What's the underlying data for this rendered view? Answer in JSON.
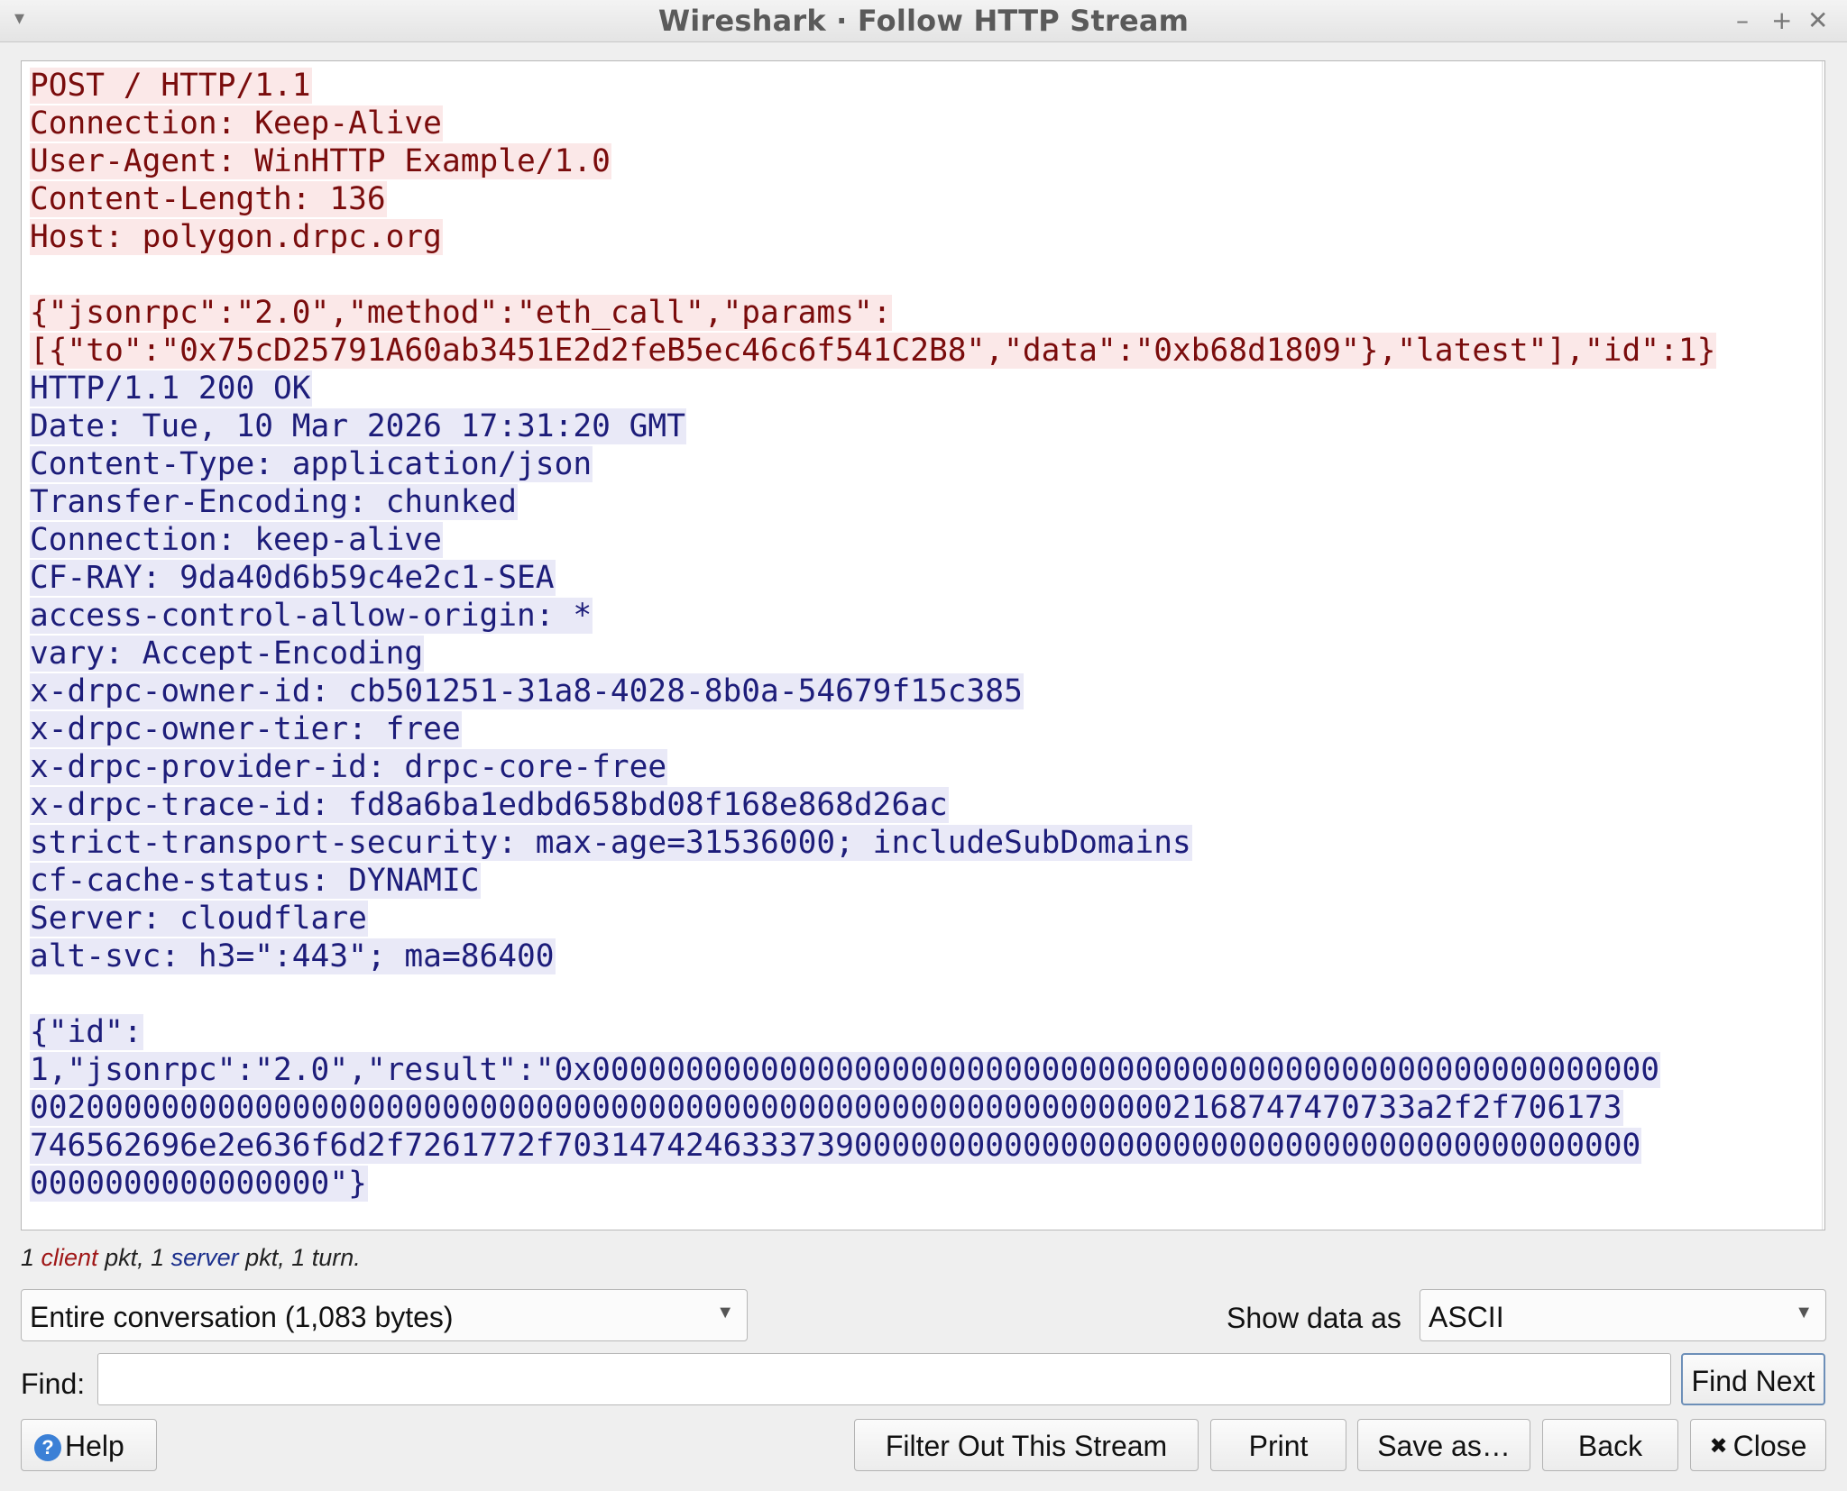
{
  "window": {
    "title": "Wireshark · Follow HTTP Stream",
    "controls": {
      "minimize": "–",
      "maximize": "+",
      "close": "✕",
      "menu": "▾"
    }
  },
  "stream": {
    "request_lines": [
      "POST / HTTP/1.1",
      "Connection: Keep-Alive",
      "User-Agent: WinHTTP Example/1.0",
      "Content-Length: 136",
      "Host: polygon.drpc.org",
      "",
      "{\"jsonrpc\":\"2.0\",\"method\":\"eth_call\",\"params\":",
      "[{\"to\":\"0x75cD25791A60ab3451E2d2feB5ec46c6f541C2B8\",\"data\":\"0xb68d1809\"},\"latest\"],\"id\":1}"
    ],
    "response_lines": [
      "HTTP/1.1 200 OK",
      "Date: Tue, 10 Mar 2026 17:31:20 GMT",
      "Content-Type: application/json",
      "Transfer-Encoding: chunked",
      "Connection: keep-alive",
      "CF-RAY: 9da40d6b59c4e2c1-SEA",
      "access-control-allow-origin: *",
      "vary: Accept-Encoding",
      "x-drpc-owner-id: cb501251-31a8-4028-8b0a-54679f15c385",
      "x-drpc-owner-tier: free",
      "x-drpc-provider-id: drpc-core-free",
      "x-drpc-trace-id: fd8a6ba1edbd658bd08f168e868d26ac",
      "strict-transport-security: max-age=31536000; includeSubDomains",
      "cf-cache-status: DYNAMIC",
      "Server: cloudflare",
      "alt-svc: h3=\":443\"; ma=86400",
      "",
      "{\"id\":",
      "1,\"jsonrpc\":\"2.0\",\"result\":\"0x000000000000000000000000000000000000000000000000000000000",
      "00200000000000000000000000000000000000000000000000000000000002168747470733a2f2f706173",
      "746562696e2e636f6d2f7261772f7031474246333739000000000000000000000000000000000000000000",
      "0000000000000000\"}"
    ]
  },
  "stats": {
    "client_count": "1",
    "client_word": "client",
    "mid1": " pkt, ",
    "server_count": "1",
    "server_word": "server",
    "mid2": " pkt, 1 turn."
  },
  "conversation_select": {
    "value": "Entire conversation (1,083 bytes)"
  },
  "show_data": {
    "label": "Show data as",
    "value": "ASCII"
  },
  "find": {
    "label": "Find:",
    "value": "",
    "next_label": "Find Next"
  },
  "buttons": {
    "help": "Help",
    "filter_out": "Filter Out This Stream",
    "print": "Print",
    "save_as": "Save as…",
    "back": "Back",
    "close": "Close"
  },
  "icons": {
    "help": "help-icon",
    "close": "close-icon",
    "dropdown": "chevron-down-icon"
  }
}
